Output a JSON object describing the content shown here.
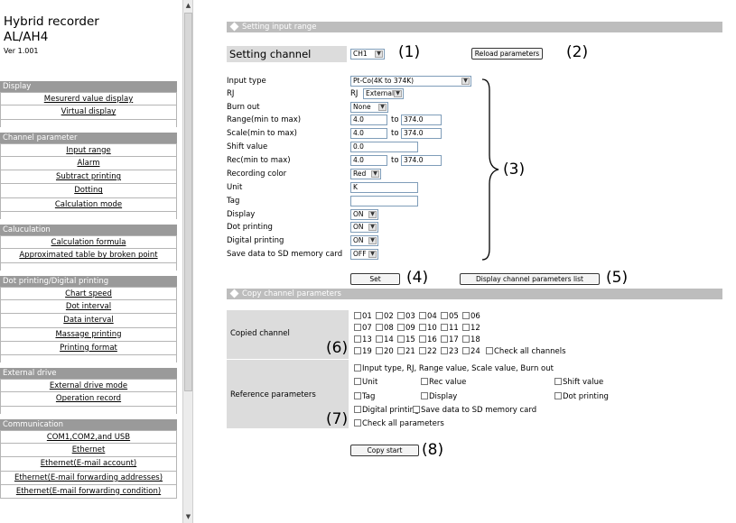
{
  "sidebar": {
    "title": "Hybrid recorder",
    "model": "AL/AH4",
    "version": "Ver 1.001",
    "groups": [
      {
        "header": "Display",
        "items": [
          "Mesurerd value display",
          "Virtual display"
        ]
      },
      {
        "header": "Channel parameter",
        "items": [
          "Input range",
          "Alarm",
          "Subtract printing",
          "Dotting",
          "Calculation mode"
        ]
      },
      {
        "header": "Caluculation",
        "items": [
          "Calculation formula",
          "Approximated table by broken point"
        ]
      },
      {
        "header": "Dot printing/Digital printing",
        "items": [
          "Chart speed",
          "Dot interval",
          "Data interval",
          "Massage printing",
          "Printing format"
        ]
      },
      {
        "header": "External drive",
        "items": [
          "External drive mode",
          "Operation record"
        ]
      },
      {
        "header": "Communication",
        "items": [
          "COM1,COM2,and USB",
          "Ethernet",
          "Ethernet(E-mail account)",
          "Ethernet(E-mail forwarding addresses)",
          "Ethernet(E-mail forwarding condition)"
        ]
      }
    ]
  },
  "setting": {
    "header": "Setting input range",
    "channel_label": "Setting channel",
    "channel_value": "CH1",
    "reload_button": "Reload parameters",
    "fields": {
      "input_type": {
        "label": "Input type",
        "value": "Pt-Co(4K to 374K)"
      },
      "rj": {
        "label": "RJ",
        "prefix": "RJ",
        "value": "External"
      },
      "burn_out": {
        "label": "Burn out",
        "value": "None"
      },
      "range": {
        "label": "Range(min to max)",
        "min": "4.0",
        "max": "374.0"
      },
      "scale": {
        "label": "Scale(min to max)",
        "min": "4.0",
        "max": "374.0"
      },
      "shift": {
        "label": "Shift value",
        "value": "0.0"
      },
      "rec": {
        "label": "Rec(min to max)",
        "min": "4.0",
        "max": "374.0"
      },
      "recording_color": {
        "label": "Recording color",
        "value": "Red"
      },
      "unit": {
        "label": "Unit",
        "value": "K"
      },
      "tag": {
        "label": "Tag",
        "value": ""
      },
      "display": {
        "label": "Display",
        "value": "ON"
      },
      "dot_printing": {
        "label": "Dot printing",
        "value": "ON"
      },
      "digital_printing": {
        "label": "Digital printing",
        "value": "ON"
      },
      "save_sd": {
        "label": "Save data to SD memory card",
        "value": "OFF"
      }
    },
    "to_label": "to",
    "set_button": "Set",
    "list_button": "Display channel parameters list"
  },
  "copy": {
    "header": "Copy channel parameters",
    "copied_label": "Copied channel",
    "channel_rows": [
      [
        "01",
        "02",
        "03",
        "04",
        "05",
        "06"
      ],
      [
        "07",
        "08",
        "09",
        "10",
        "11",
        "12"
      ],
      [
        "13",
        "14",
        "15",
        "16",
        "17",
        "18"
      ],
      [
        "19",
        "20",
        "21",
        "22",
        "23",
        "24"
      ]
    ],
    "check_all_channels": "Check all channels",
    "reference_label": "Reference parameters",
    "ref_line1": "Input type, RJ, Range value, Scale value, Burn out",
    "ref_unit": "Unit",
    "ref_rec": "Rec value",
    "ref_shift": "Shift value",
    "ref_tag": "Tag",
    "ref_display": "Display",
    "ref_dot": "Dot printing",
    "ref_digital": "Digital printing",
    "ref_save": "Save data to SD memory card",
    "ref_check_all": "Check all parameters",
    "copy_button": "Copy start"
  },
  "callouts": [
    "(1)",
    "(2)",
    "(3)",
    "(4)",
    "(5)",
    "(6)",
    "(7)",
    "(8)"
  ]
}
